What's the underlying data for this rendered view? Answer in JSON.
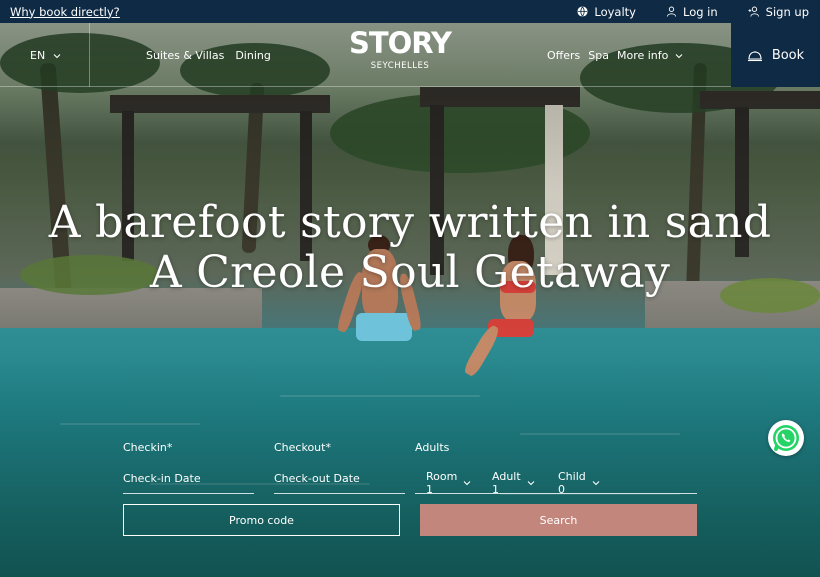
{
  "topbar": {
    "why_book": "Why book directly?",
    "loyalty": "Loyalty",
    "login": "Log in",
    "signup": "Sign up",
    "icons": [
      "globe-icon",
      "user-icon",
      "add-user-icon"
    ]
  },
  "nav": {
    "language": "EN",
    "left_links": [
      "Suites & Villas",
      "Dining"
    ],
    "logo": {
      "brand": "STORY",
      "sub": "SEYCHELLES"
    },
    "right_links": [
      "Offers",
      "Spa",
      "More info"
    ],
    "book": "Book"
  },
  "hero": {
    "line1": "A barefoot story written in sand",
    "line2": "A Creole Soul Getaway"
  },
  "booking": {
    "checkin_label": "Checkin*",
    "checkin_placeholder": "Check-in Date",
    "checkout_label": "Checkout*",
    "checkout_placeholder": "Check-out Date",
    "adults_label": "Adults",
    "room": "Room 1",
    "adult": "Adult 1",
    "child": "Child 0",
    "promo": "Promo code",
    "search": "Search"
  },
  "colors": {
    "navy": "#0f2a44",
    "search_button": "#c3867c",
    "whatsapp": "#25d366"
  }
}
